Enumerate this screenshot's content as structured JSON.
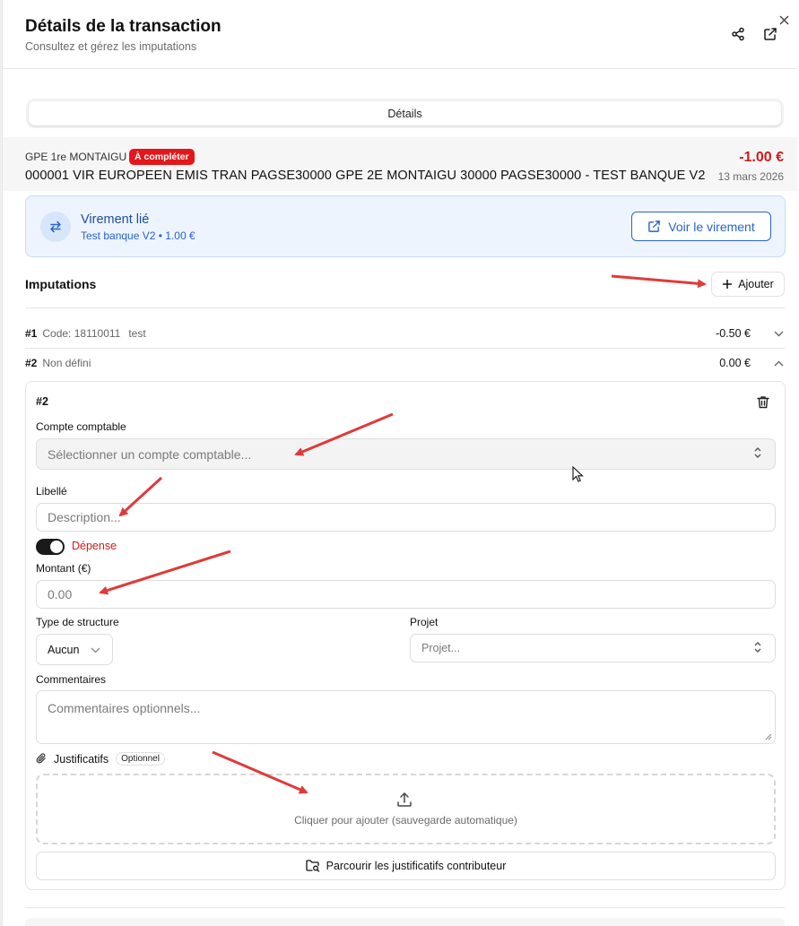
{
  "header": {
    "title": "Détails de la transaction",
    "subtitle": "Consultez et gérez les imputations"
  },
  "tabs": [
    {
      "label": "Détails",
      "active": true
    }
  ],
  "transaction": {
    "bank_account": "GPE 1re MONTAIGU",
    "status_badge": "À compléter",
    "label": "000001 VIR EUROPEEN EMIS TRAN PAGSE30000 GPE 2E MONTAIGU 30000 PAGSE30000 - TEST BANQUE V2",
    "amount": "-1.00 €",
    "date": "13 mars 2026"
  },
  "linked_transfer": {
    "title": "Virement lié",
    "subtitle": "Test banque V2 • 1.00 €",
    "button_label": "Voir le virement"
  },
  "imputations": {
    "title": "Imputations",
    "add_label": "Ajouter",
    "rows": [
      {
        "num": "#1",
        "code": "Code: 18110011",
        "desc": "test",
        "amount": "-0.50 €",
        "expanded": false
      },
      {
        "num": "#2",
        "code": "Non défini",
        "desc": "",
        "amount": "0.00 €",
        "expanded": true
      }
    ]
  },
  "form": {
    "title": "#2",
    "account_label": "Compte comptable",
    "account_placeholder": "Sélectionner un compte comptable...",
    "libelle_label": "Libellé",
    "libelle_placeholder": "Description...",
    "toggle_label": "Dépense",
    "amount_label": "Montant (€)",
    "amount_placeholder": "0.00",
    "structure_label": "Type de structure",
    "structure_value": "Aucun",
    "project_label": "Projet",
    "project_placeholder": "Projet...",
    "comments_label": "Commentaires",
    "comments_placeholder": "Commentaires optionnels...",
    "attachments_label": "Justificatifs",
    "attachments_badge": "Optionnel",
    "dropzone_text": "Cliquer pour ajouter (sauvegarde automatique)",
    "browse_label": "Parcourir les justificatifs contributeur"
  },
  "colors": {
    "danger": "#d01a1a",
    "badge": "#e3171b",
    "accent": "#2a63c9",
    "annotation_arrow": "#e03a3a"
  },
  "icons": [
    "share-icon",
    "external-link-icon",
    "close-icon",
    "swap-icon",
    "plus-icon",
    "chevron-down-icon",
    "chevron-up-icon",
    "trash-icon",
    "updown-icon",
    "paperclip-icon",
    "upload-icon",
    "folder-search-icon"
  ]
}
